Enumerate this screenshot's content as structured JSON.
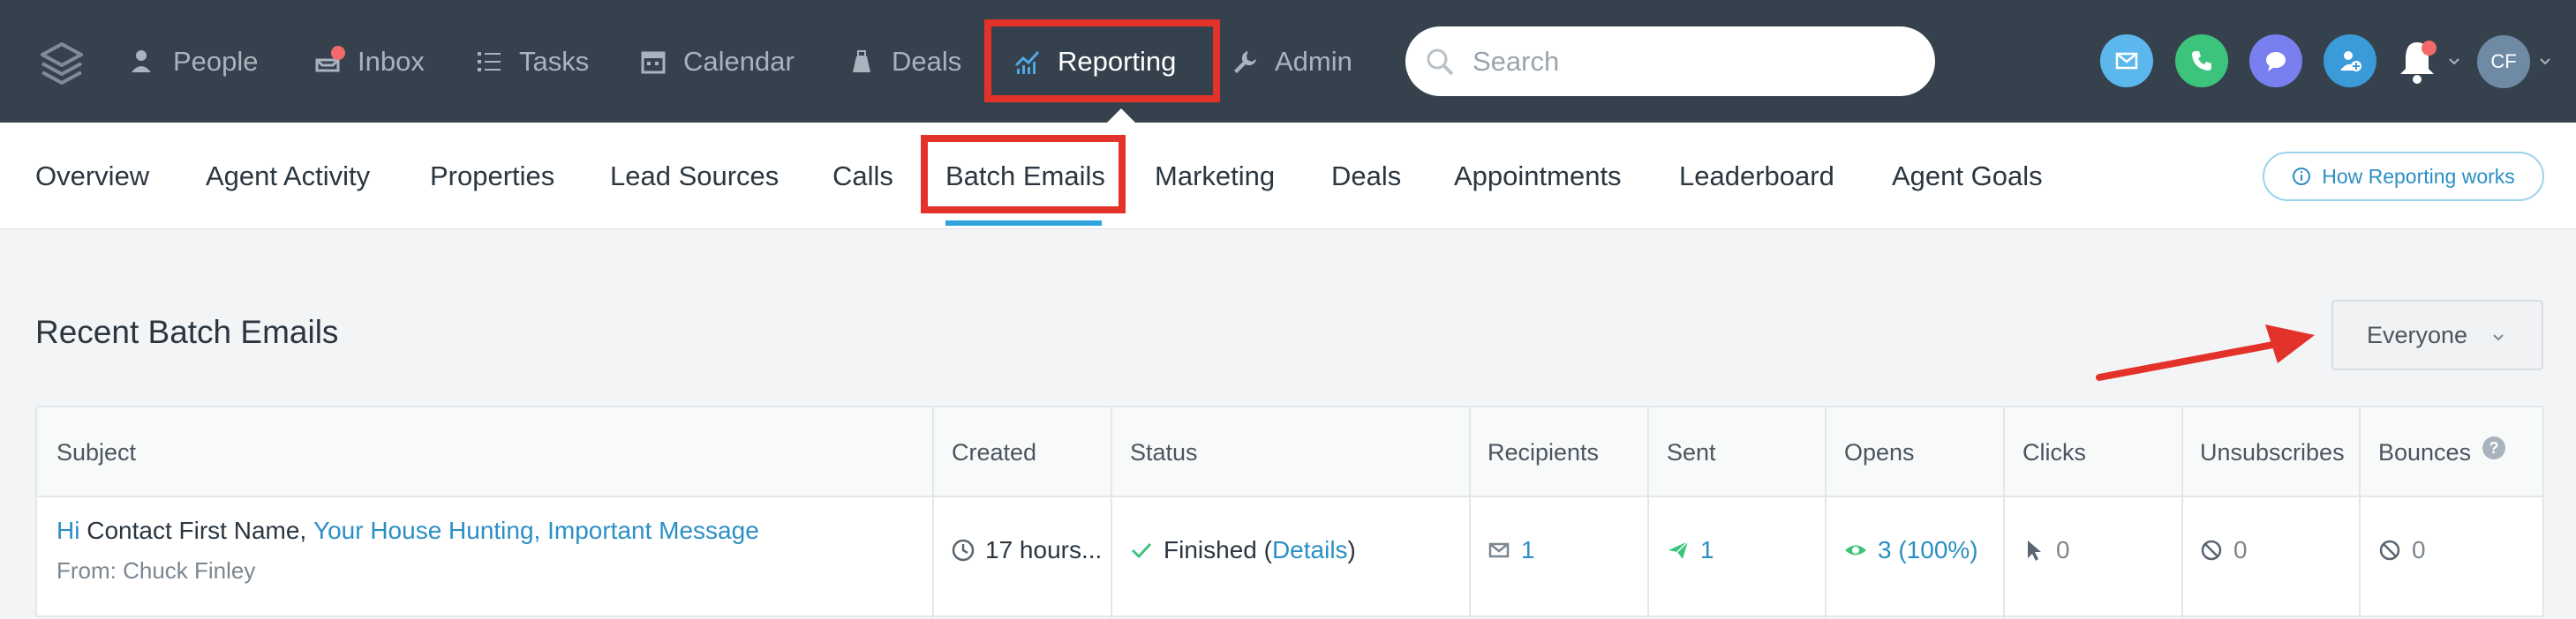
{
  "nav": {
    "items": [
      {
        "label": "People",
        "icon": "people-icon"
      },
      {
        "label": "Inbox",
        "icon": "inbox-icon"
      },
      {
        "label": "Tasks",
        "icon": "tasks-icon"
      },
      {
        "label": "Calendar",
        "icon": "calendar-icon"
      },
      {
        "label": "Deals",
        "icon": "deals-icon"
      },
      {
        "label": "Reporting",
        "icon": "reporting-icon"
      },
      {
        "label": "Admin",
        "icon": "wrench-icon"
      }
    ],
    "active": "Reporting"
  },
  "search": {
    "placeholder": "Search"
  },
  "user": {
    "initials": "CF"
  },
  "actions": {
    "colors": {
      "email": "#5cb8ec",
      "phone": "#3cc47c",
      "chat": "#7a7ff0",
      "add_contact": "#3a9bd8"
    }
  },
  "subnav": {
    "items": [
      "Overview",
      "Agent Activity",
      "Properties",
      "Lead Sources",
      "Calls",
      "Batch Emails",
      "Marketing",
      "Deals",
      "Appointments",
      "Leaderboard",
      "Agent Goals"
    ],
    "active": "Batch Emails",
    "help_label": "How Reporting works"
  },
  "section": {
    "title": "Recent Batch Emails",
    "filter_value": "Everyone"
  },
  "table": {
    "headers": [
      "Subject",
      "Created",
      "Status",
      "Recipients",
      "Sent",
      "Opens",
      "Clicks",
      "Unsubscribes",
      "Bounces"
    ],
    "rows": [
      {
        "subject_prefix": "Hi",
        "subject_mid": "Contact First Name,",
        "subject_rest": "Your House Hunting, Important Message",
        "from": "From: Chuck Finley",
        "created": "17 hours...",
        "status": "Finished",
        "status_open": " (",
        "status_link": "Details",
        "status_close": ")",
        "recipients": "1",
        "sent": "1",
        "opens": "3 (100%)",
        "clicks": "0",
        "unsubscribes": "0",
        "bounces": "0"
      }
    ]
  },
  "accent": "#e3322a"
}
